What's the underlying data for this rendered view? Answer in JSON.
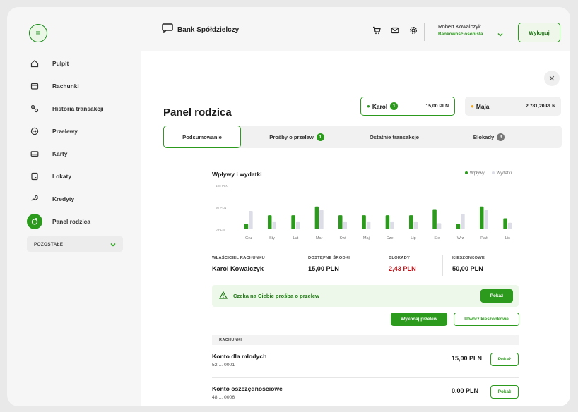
{
  "sidebar": {
    "items": [
      {
        "label": "Pulpit",
        "icon": "home-icon"
      },
      {
        "label": "Rachunki",
        "icon": "wallet-icon"
      },
      {
        "label": "Historia transakcji",
        "icon": "history-icon"
      },
      {
        "label": "Przelewy",
        "icon": "transfer-icon"
      },
      {
        "label": "Karty",
        "icon": "card-icon"
      },
      {
        "label": "Lokaty",
        "icon": "deposit-icon"
      },
      {
        "label": "Kredyty",
        "icon": "loan-icon"
      },
      {
        "label": "Panel rodzica",
        "icon": "parent-panel-icon",
        "active": true
      }
    ],
    "other_label": "POZOSTAŁE"
  },
  "header": {
    "brand": "Bank Spółdzielczy",
    "user_name": "Robert Kowalczyk",
    "user_role": "Bankowość osobista",
    "logout_label": "Wyloguj"
  },
  "main": {
    "title": "Panel rodzica",
    "accounts": [
      {
        "name": "Karol",
        "badge": "1",
        "amount": "15,00 PLN",
        "dot_color": "#2c9a1d"
      },
      {
        "name": "Maja",
        "amount": "2 781,20 PLN",
        "dot_color": "#f2a81d"
      }
    ],
    "tabs": [
      {
        "label": "Podsumowanie"
      },
      {
        "label": "Prośby o przelew",
        "badge": "1"
      },
      {
        "label": "Ostatnie transakcje"
      },
      {
        "label": "Blokady",
        "badge": "3"
      }
    ],
    "chart_title": "Wpływy i wydatki",
    "legend": {
      "income": "Wpływy",
      "expense": "Wydatki"
    },
    "info": [
      {
        "label": "WŁAŚCICIEL RACHUNKU",
        "value": "Karol Kowalczyk"
      },
      {
        "label": "DOSTĘPNE ŚRODKI",
        "value": "15,00 PLN"
      },
      {
        "label": "BLOKADY",
        "value": "2,43 PLN"
      },
      {
        "label": "KIESZONKOWE",
        "value": "50,00 PLN"
      }
    ],
    "alert_text": "Czeka na Ciebie prośba o przelew",
    "alert_button": "Pokaż",
    "transfer_button": "Wykonaj przelew",
    "pocket_button": "Utwórz kieszonkowe",
    "section_label": "RACHUNKI",
    "rows": [
      {
        "name": "Konto dla młodych",
        "number": "52 ... 0001",
        "balance": "15,00 PLN",
        "button": "Pokaż"
      },
      {
        "name": "Konto oszczędnościowe",
        "number": "48 ... 0006",
        "balance": "0,00 PLN",
        "button": "Pokaż"
      }
    ]
  },
  "colors": {
    "accent": "#2c9a1d",
    "expense": "#dcdde6",
    "alert": "#c0161b"
  },
  "chart_data": {
    "type": "bar",
    "title": "Wpływy i wydatki",
    "categories": [
      "Gru",
      "Sty",
      "Lut",
      "Mar",
      "Kwi",
      "Maj",
      "Cze",
      "Lip",
      "Sie",
      "Wrz",
      "Paź",
      "Lis"
    ],
    "y_ticks": [
      "100 PLN",
      "50 PLN",
      "0 PLN"
    ],
    "ylim": [
      0,
      100
    ],
    "series": [
      {
        "name": "Wpływy",
        "color": "#2c9a1d",
        "values": [
          12,
          32,
          32,
          52,
          32,
          32,
          32,
          32,
          46,
          12,
          52,
          25
        ]
      },
      {
        "name": "Wydatki",
        "color": "#dcdde6",
        "values": [
          42,
          18,
          18,
          44,
          18,
          18,
          18,
          18,
          14,
          35,
          44,
          15
        ]
      }
    ]
  }
}
